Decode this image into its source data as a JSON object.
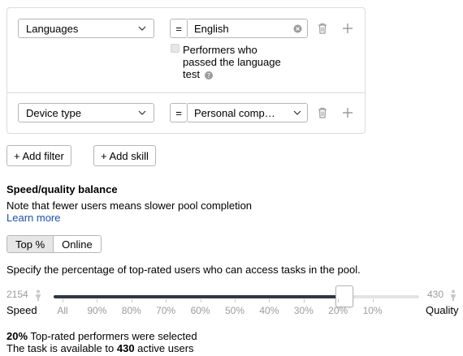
{
  "filters": [
    {
      "field": "Languages",
      "operator": "=",
      "value": "English",
      "checkbox_label_lines": [
        "Performers who",
        "passed the language",
        "test"
      ]
    },
    {
      "field": "Device type",
      "operator": "=",
      "value": "Personal comp…"
    }
  ],
  "actions": {
    "add_filter": "+ Add filter",
    "add_skill": "+ Add skill"
  },
  "balance": {
    "title": "Speed/quality balance",
    "note": "Note that fewer users means slower pool completion",
    "learn_more": "Learn more",
    "tabs": [
      "Top %",
      "Online"
    ],
    "active_tab": "Top %",
    "description": "Specify the percentage of top-rated users who can access tasks in the pool."
  },
  "slider": {
    "left_count": "2154",
    "right_count": "430",
    "left_label": "Speed",
    "right_label": "Quality",
    "ticks": [
      "All",
      "90%",
      "80%",
      "70%",
      "60%",
      "50%",
      "40%",
      "30%",
      "20%",
      "10%"
    ],
    "selected_tick": "20%",
    "fill_fraction": 0.8
  },
  "summary": {
    "line1_bold": "20%",
    "line1_rest": " Top-rated performers were selected",
    "line2_pre": "The task is available to ",
    "line2_bold": "430",
    "line2_post": " active users"
  },
  "colors": {
    "accent_dark": "#2f3747",
    "link": "#1a4fb5",
    "muted": "#9b9b9b",
    "border": "#dcdcdc"
  }
}
